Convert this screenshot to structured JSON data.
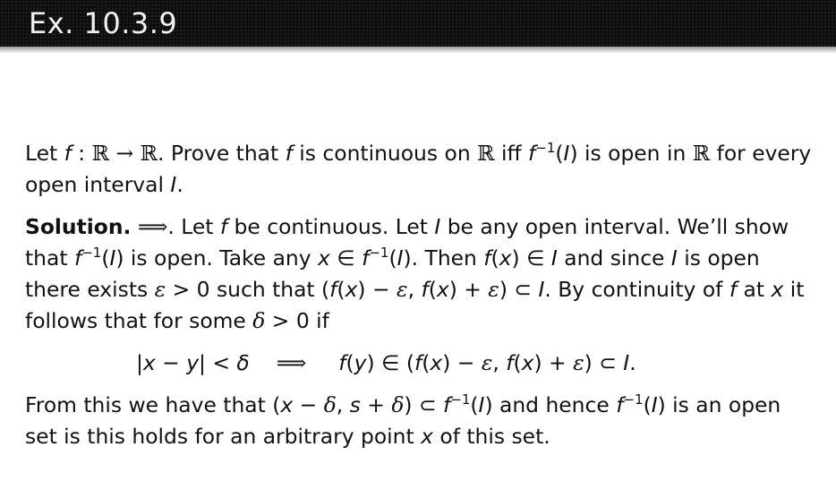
{
  "slide": {
    "title": "Ex. 10.3.9"
  },
  "problem": {
    "p1": "Let ",
    "f1": "f",
    "colon": " : ",
    "R1": "ℝ",
    "arrow1": " → ",
    "R2": "ℝ",
    "p2": ". Prove that ",
    "f2": "f",
    "p3": " is continuous on ",
    "R3": "ℝ",
    "p4": " iff ",
    "f3": "f",
    "inv1": "−1",
    "p5": "(",
    "I1": "I",
    "p6": ") is open in ",
    "R4": "ℝ",
    "p7": " for every open interval ",
    "I2": "I",
    "p8": "."
  },
  "solution": {
    "label": "Solution.",
    "impl": " ⟹",
    "s1": ". Let ",
    "f1": "f",
    "s2": " be continuous. Let ",
    "I1": "I",
    "s3": " be any open interval. We’ll show that ",
    "f2": "f",
    "inv1": "−1",
    "s4": "(",
    "I2": "I",
    "s5": ") is open. Take any ",
    "x1": "x",
    "in1": " ∈ ",
    "f3": "f",
    "inv2": "−1",
    "s6": "(",
    "I3": "I",
    "s7": "). Then ",
    "fx1": "f",
    "s8": "(",
    "x2": "x",
    "s9": ") ∈ ",
    "I4": "I",
    "s10": " and since ",
    "I5": "I",
    "s11": " is open there exists ",
    "eps1": "ε",
    "s12": " > 0 such that (",
    "fx2": "f",
    "s13": "(",
    "x3": "x",
    "s14": ") − ",
    "eps2": "ε",
    "s15": ", ",
    "fx3": "f",
    "s16": "(",
    "x4": "x",
    "s17": ") + ",
    "eps3": "ε",
    "s18": ") ⊂ ",
    "I6": "I",
    "s19": ". By continuity of ",
    "f4": "f",
    "s20": " at ",
    "x5": "x",
    "s21": " it follows that for some ",
    "delta1": "δ",
    "s22": " > 0 if"
  },
  "display": {
    "lhs": "|x − y| < δ",
    "implies": "⟹",
    "rhs_f": "f",
    "rhs1": "(",
    "rhs_y": "y",
    "rhs2": ") ∈ (",
    "rhs_f2": "f",
    "rhs3": "(",
    "rhs_x": "x",
    "rhs4": ") − ",
    "rhs_e": "ε",
    "rhs5": ", ",
    "rhs_f3": "f",
    "rhs6": "(",
    "rhs_x2": "x",
    "rhs7": ") + ",
    "rhs_e2": "ε",
    "rhs8": ") ⊂ ",
    "rhs_I": "I",
    "rhs9": "."
  },
  "conclusion": {
    "c1": "From this we have that (",
    "x1": "x",
    "c2": " − ",
    "d1": "δ",
    "c3": ", ",
    "s": "s",
    "c4": " + ",
    "d2": "δ",
    "c5": ") ⊂ ",
    "f1": "f",
    "inv1": "−1",
    "c6": "(",
    "I1": "I",
    "c7": ") and hence ",
    "f2": "f",
    "inv2": "−1",
    "c8": "(",
    "I2": "I",
    "c9": ") is an open set is this holds for an arbitrary point ",
    "x2": "x",
    "c10": " of this set."
  }
}
